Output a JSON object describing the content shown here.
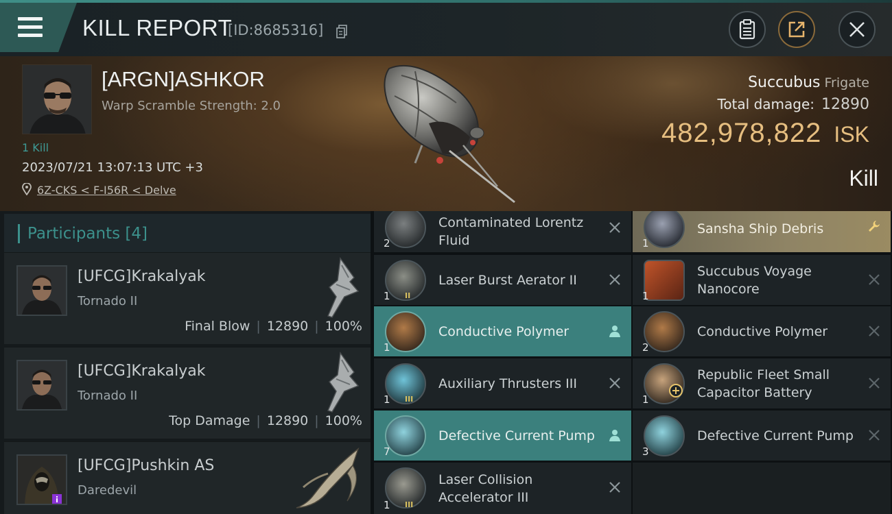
{
  "header": {
    "title": "KILL REPORT",
    "report_id": "[ID:8685316]",
    "icons": [
      "menu-icon",
      "copy-icon",
      "clipboard-icon",
      "share-icon",
      "close-icon"
    ]
  },
  "victim": {
    "name": "[ARGN]ASHKOR",
    "subtitle": "Warp Scramble Strength: 2.0",
    "kills": "1 Kill",
    "timestamp": "2023/07/21 13:07:13 UTC +3",
    "location": "6Z-CKS < F-I56R < Delve",
    "ship": "Succubus",
    "ship_class": "Frigate",
    "total_damage_label": "Total damage:",
    "total_damage": "12890",
    "isk_value": "482,978,822",
    "isk_unit": "ISK",
    "result": "Kill"
  },
  "participants": {
    "title": "Participants",
    "count": "[4]",
    "list": [
      {
        "name": "[UFCG]Krakalyak",
        "ship": "Tornado II",
        "role": "Final Blow",
        "damage": "12890",
        "percent": "100%"
      },
      {
        "name": "[UFCG]Krakalyak",
        "ship": "Tornado II",
        "role": "Top Damage",
        "damage": "12890",
        "percent": "100%"
      },
      {
        "name": "[UFCG]Pushkin AS",
        "ship": "Daredevil"
      }
    ]
  },
  "items": {
    "col1": [
      {
        "name": "Contaminated Lorentz Fluid",
        "qty": "2",
        "state": "destroyed",
        "action_icon": "close-icon"
      },
      {
        "name": "Laser Burst Aerator II",
        "qty": "1",
        "tier": "II",
        "state": "destroyed",
        "action_icon": "close-icon"
      },
      {
        "name": "Conductive Polymer",
        "qty": "1",
        "state": "dropped",
        "action_icon": "person-icon"
      },
      {
        "name": "Auxiliary Thrusters III",
        "qty": "1",
        "tier": "III",
        "state": "destroyed",
        "action_icon": "close-icon"
      },
      {
        "name": "Defective Current Pump",
        "qty": "7",
        "state": "dropped",
        "action_icon": "person-icon"
      },
      {
        "name": "Laser Collision Accelerator III",
        "qty": "1",
        "tier": "III",
        "state": "destroyed",
        "action_icon": "close-icon"
      }
    ],
    "col2": [
      {
        "name": "Sansha Ship Debris",
        "qty": "1",
        "state": "special",
        "action_icon": "wrench-icon"
      },
      {
        "name": "Succubus Voyage Nanocore",
        "qty": "1",
        "state": "destroyed",
        "action_icon": "close-icon"
      },
      {
        "name": "Conductive Polymer",
        "qty": "2",
        "state": "destroyed",
        "action_icon": "close-icon"
      },
      {
        "name": "Republic Fleet Small Capacitor Battery",
        "qty": "1",
        "state": "destroyed",
        "action_icon": "close-icon"
      },
      {
        "name": "Defective Current Pump",
        "qty": "3",
        "state": "destroyed",
        "action_icon": "close-icon"
      }
    ]
  },
  "colors": {
    "accent_teal": "#3c918c",
    "isk_gold": "#e6be80",
    "dropped_row": "#3b807d",
    "special_row": "#8f8465"
  }
}
